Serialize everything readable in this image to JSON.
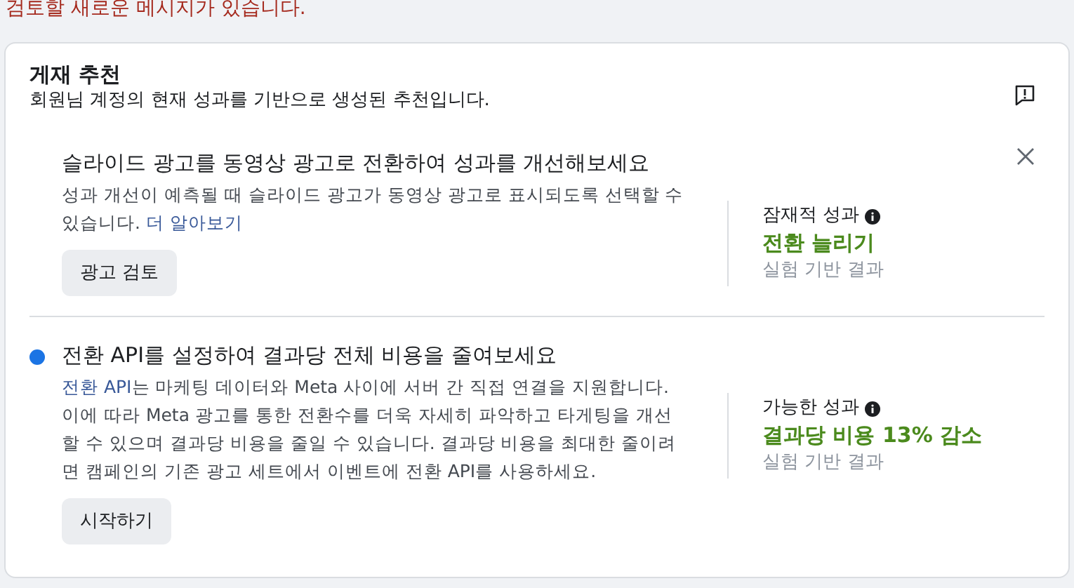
{
  "notice": "검토할 새로운 메시지가 있습니다.",
  "card": {
    "title": "게재 추천",
    "subtitle": "회원님 계정의 현재 성과를 기반으로 생성된 추천입니다."
  },
  "recommendations": [
    {
      "title": "슬라이드 광고를 동영상 광고로 전환하여 성과를 개선해보세요",
      "new": false,
      "dismissible": true,
      "link_first": false,
      "text": "성과 개선이 예측될 때 슬라이드 광고가 동영상 광고로 표시되도록 선택할 수 있습니다. ",
      "link": "더 알아보기",
      "button": "광고 검토",
      "outcome_label": "잠재적 성과",
      "outcome": "전환 늘리기",
      "outcome_note": "실험 기반 결과"
    },
    {
      "title": "전환 API를 설정하여 결과당 전체 비용을 줄여보세요",
      "new": true,
      "dismissible": false,
      "link_first": true,
      "text": "는 마케팅 데이터와 Meta 사이에 서버 간 직접 연결을 지원합니다. 이에 따라 Meta 광고를 통한 전환수를 더욱 자세히 파악하고 타게팅을 개선할 수 있으며 결과당 비용을 줄일 수 있습니다. 결과당 비용을 최대한 줄이려면 캠페인의 기존 광고 세트에서 이벤트에 전환 API를 사용하세요.",
      "link": "전환 API",
      "button": "시작하기",
      "outcome_label": "가능한 성과",
      "outcome": "결과당 비용 13% 감소",
      "outcome_note": "실험 기반 결과"
    }
  ]
}
